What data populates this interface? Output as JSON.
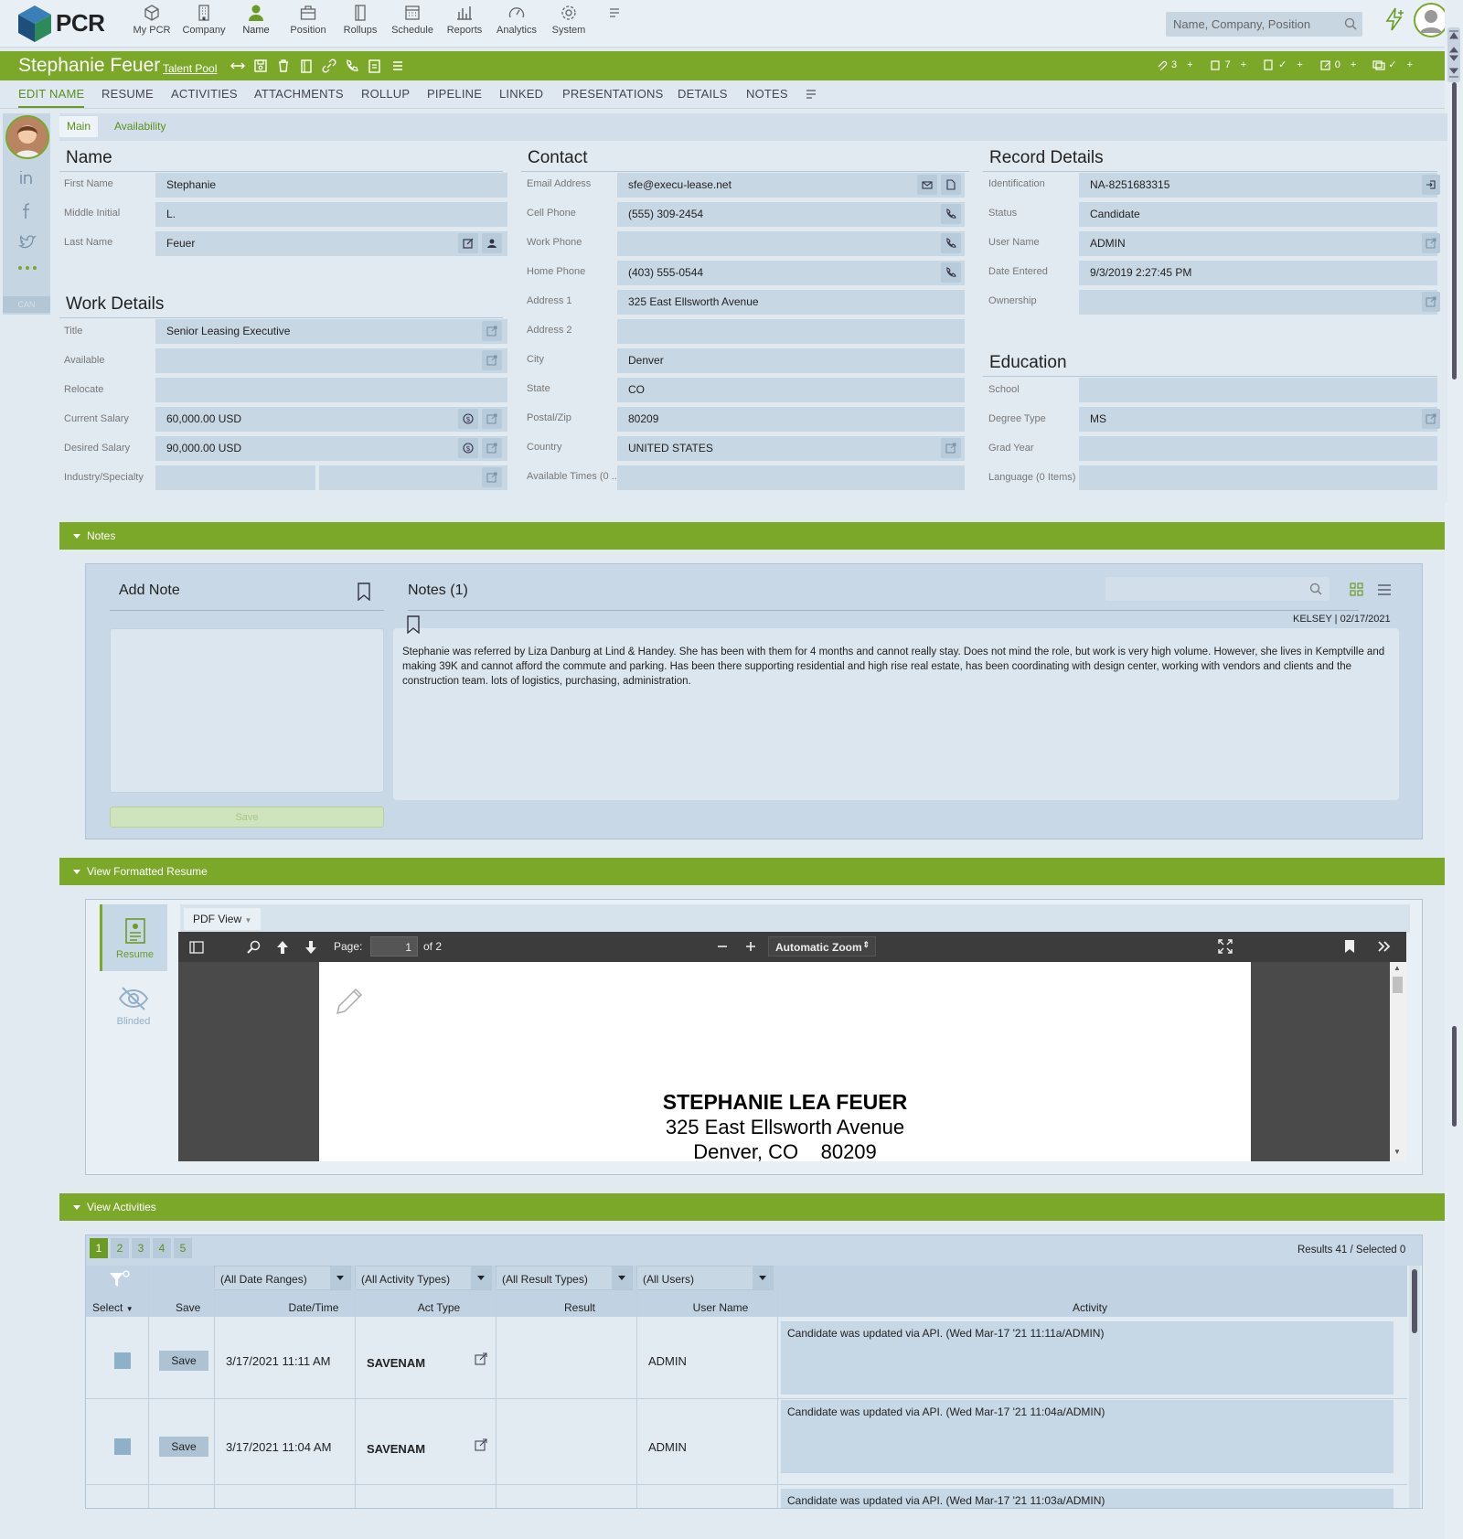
{
  "app": {
    "name": "PCR"
  },
  "nav": {
    "items": [
      {
        "label": "My PCR",
        "icon": "cube-icon"
      },
      {
        "label": "Company",
        "icon": "building-icon"
      },
      {
        "label": "Name",
        "icon": "person-icon"
      },
      {
        "label": "Position",
        "icon": "briefcase-icon"
      },
      {
        "label": "Rollups",
        "icon": "folders-icon"
      },
      {
        "label": "Schedule",
        "icon": "calendar-icon"
      },
      {
        "label": "Reports",
        "icon": "bar-chart-icon"
      },
      {
        "label": "Analytics",
        "icon": "gauge-icon"
      },
      {
        "label": "System",
        "icon": "gear-icon"
      }
    ],
    "search_placeholder": "Name, Company, Position"
  },
  "record": {
    "name": "Stephanie Feuer",
    "pool": "Talent Pool",
    "counters": [
      "3",
      "7",
      "✓",
      "0",
      "✓"
    ]
  },
  "tabs": [
    "EDIT NAME",
    "RESUME",
    "ACTIVITIES",
    "ATTACHMENTS",
    "ROLLUP",
    "PIPELINE",
    "LINKED",
    "PRESENTATIONS",
    "DETAILS",
    "NOTES"
  ],
  "rail": {
    "badge": "CAN"
  },
  "subtabs": [
    "Main",
    "Availability"
  ],
  "name_section": {
    "title": "Name",
    "fields": [
      {
        "label": "First Name",
        "value": "Stephanie"
      },
      {
        "label": "Middle Initial",
        "value": "L."
      },
      {
        "label": "Last Name",
        "value": "Feuer"
      }
    ]
  },
  "work_section": {
    "title": "Work Details",
    "fields": [
      {
        "label": "Title",
        "value": "Senior Leasing Executive"
      },
      {
        "label": "Available",
        "value": ""
      },
      {
        "label": "Relocate",
        "value": ""
      },
      {
        "label": "Current Salary",
        "value": "60,000.00 USD"
      },
      {
        "label": "Desired Salary",
        "value": "90,000.00 USD"
      },
      {
        "label": "Industry/Specialty",
        "value": ""
      }
    ]
  },
  "contact_section": {
    "title": "Contact",
    "fields": [
      {
        "label": "Email Address",
        "value": "sfe@execu-lease.net"
      },
      {
        "label": "Cell Phone",
        "value": "(555) 309-2454"
      },
      {
        "label": "Work Phone",
        "value": ""
      },
      {
        "label": "Home Phone",
        "value": "(403) 555-0544"
      },
      {
        "label": "Address 1",
        "value": "325 East Ellsworth Avenue"
      },
      {
        "label": "Address 2",
        "value": ""
      },
      {
        "label": "City",
        "value": "Denver"
      },
      {
        "label": "State",
        "value": "CO"
      },
      {
        "label": "Postal/Zip",
        "value": "80209"
      },
      {
        "label": "Country",
        "value": "UNITED STATES"
      },
      {
        "label": "Available Times (0 ...",
        "value": ""
      }
    ]
  },
  "record_section": {
    "title": "Record Details",
    "fields": [
      {
        "label": "Identification",
        "value": "NA-8251683315"
      },
      {
        "label": "Status",
        "value": "Candidate"
      },
      {
        "label": "User Name",
        "value": "ADMIN"
      },
      {
        "label": "Date Entered",
        "value": "9/3/2019 2:27:45 PM"
      },
      {
        "label": "Ownership",
        "value": ""
      }
    ]
  },
  "education_section": {
    "title": "Education",
    "fields": [
      {
        "label": "School",
        "value": ""
      },
      {
        "label": "Degree Type",
        "value": "MS"
      },
      {
        "label": "Grad Year",
        "value": ""
      },
      {
        "label": "Language (0 Items)",
        "value": ""
      }
    ]
  },
  "notes": {
    "bar_label": "Notes",
    "add_note": "Add Note",
    "save": "Save",
    "list_title": "Notes (1)",
    "note_author": "KELSEY | 02/17/2021",
    "note_text": "Stephanie was referred by Liza Danburg at Lind & Handey. She has been with them for 4 months and cannot really stay. Does not mind the role, but work is very high volume. However, she lives in Kemptville and making 39K and cannot afford the commute and parking. Has been there supporting residential and high rise real estate, has been coordinating with design center, working with vendors and clients and the construction team. lots of logistics, purchasing, administration."
  },
  "resume": {
    "bar_label": "View Formatted Resume",
    "side_resume": "Resume",
    "side_blinded": "Blinded",
    "view_select": "PDF View",
    "page_label": "Page:",
    "page_num": "1",
    "page_of": "of 2",
    "zoom": "Automatic Zoom",
    "doc_name": "STEPHANIE LEA FEUER",
    "doc_addr1": "325 East Ellsworth Avenue",
    "doc_addr2": "Denver, CO    80209"
  },
  "activities": {
    "bar_label": "View Activities",
    "pages": [
      "1",
      "2",
      "3",
      "4",
      "5"
    ],
    "results": "Results 41 / Selected 0",
    "filters": [
      "(All Date Ranges)",
      "(All Activity Types)",
      "(All Result Types)",
      "(All Users)"
    ],
    "headers": {
      "select": "Select",
      "save": "Save",
      "date": "Date/Time",
      "type": "Act Type",
      "result": "Result",
      "user": "User Name",
      "activity": "Activity"
    },
    "rows": [
      {
        "save": "Save",
        "date": "3/17/2021 11:11 AM",
        "type": "SAVENAM",
        "result": "",
        "user": "ADMIN",
        "activity": "Candidate was updated via API. (Wed Mar-17 '21 11:11a/ADMIN)"
      },
      {
        "save": "Save",
        "date": "3/17/2021 11:04 AM",
        "type": "SAVENAM",
        "result": "",
        "user": "ADMIN",
        "activity": "Candidate was updated via API. (Wed Mar-17 '21 11:04a/ADMIN)"
      },
      {
        "activity": "Candidate was updated via API. (Wed Mar-17 '21 11:03a/ADMIN)"
      }
    ]
  }
}
